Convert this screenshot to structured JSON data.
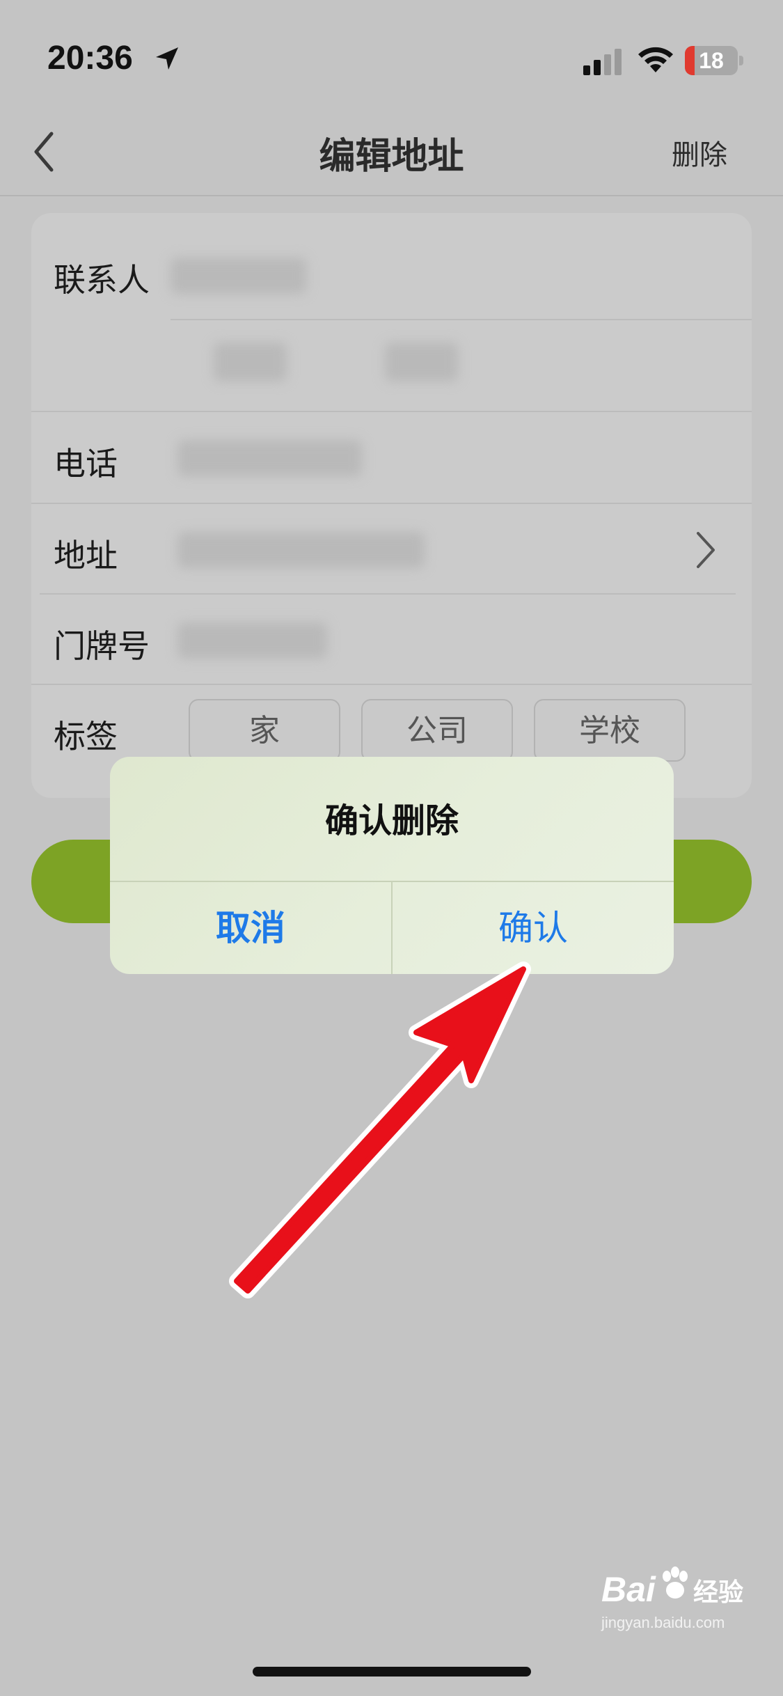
{
  "status_bar": {
    "time": "20:36",
    "battery_level": "18",
    "battery_fraction": 0.18,
    "battery_color": "#e03a2f",
    "icons": [
      "location-arrow-icon",
      "cellular-signal-icon",
      "wifi-icon",
      "battery-icon"
    ]
  },
  "nav": {
    "back_icon": "chevron-left-icon",
    "title": "编辑地址",
    "delete_label": "删除"
  },
  "form": {
    "contact_label": "联系人",
    "phone_label": "电话",
    "address_label": "地址",
    "house_number_label": "门牌号",
    "tag_label": "标签",
    "tags": [
      "家",
      "公司",
      "学校"
    ],
    "address_chevron_icon": "chevron-right-icon"
  },
  "dialog": {
    "title": "确认删除",
    "cancel_label": "取消",
    "confirm_label": "确认",
    "button_color": "#1e7ae8"
  },
  "accent_color": "#7da325",
  "watermark": {
    "brand": "Bai",
    "brand_suffix": "经验",
    "url": "jingyan.baidu.com"
  }
}
